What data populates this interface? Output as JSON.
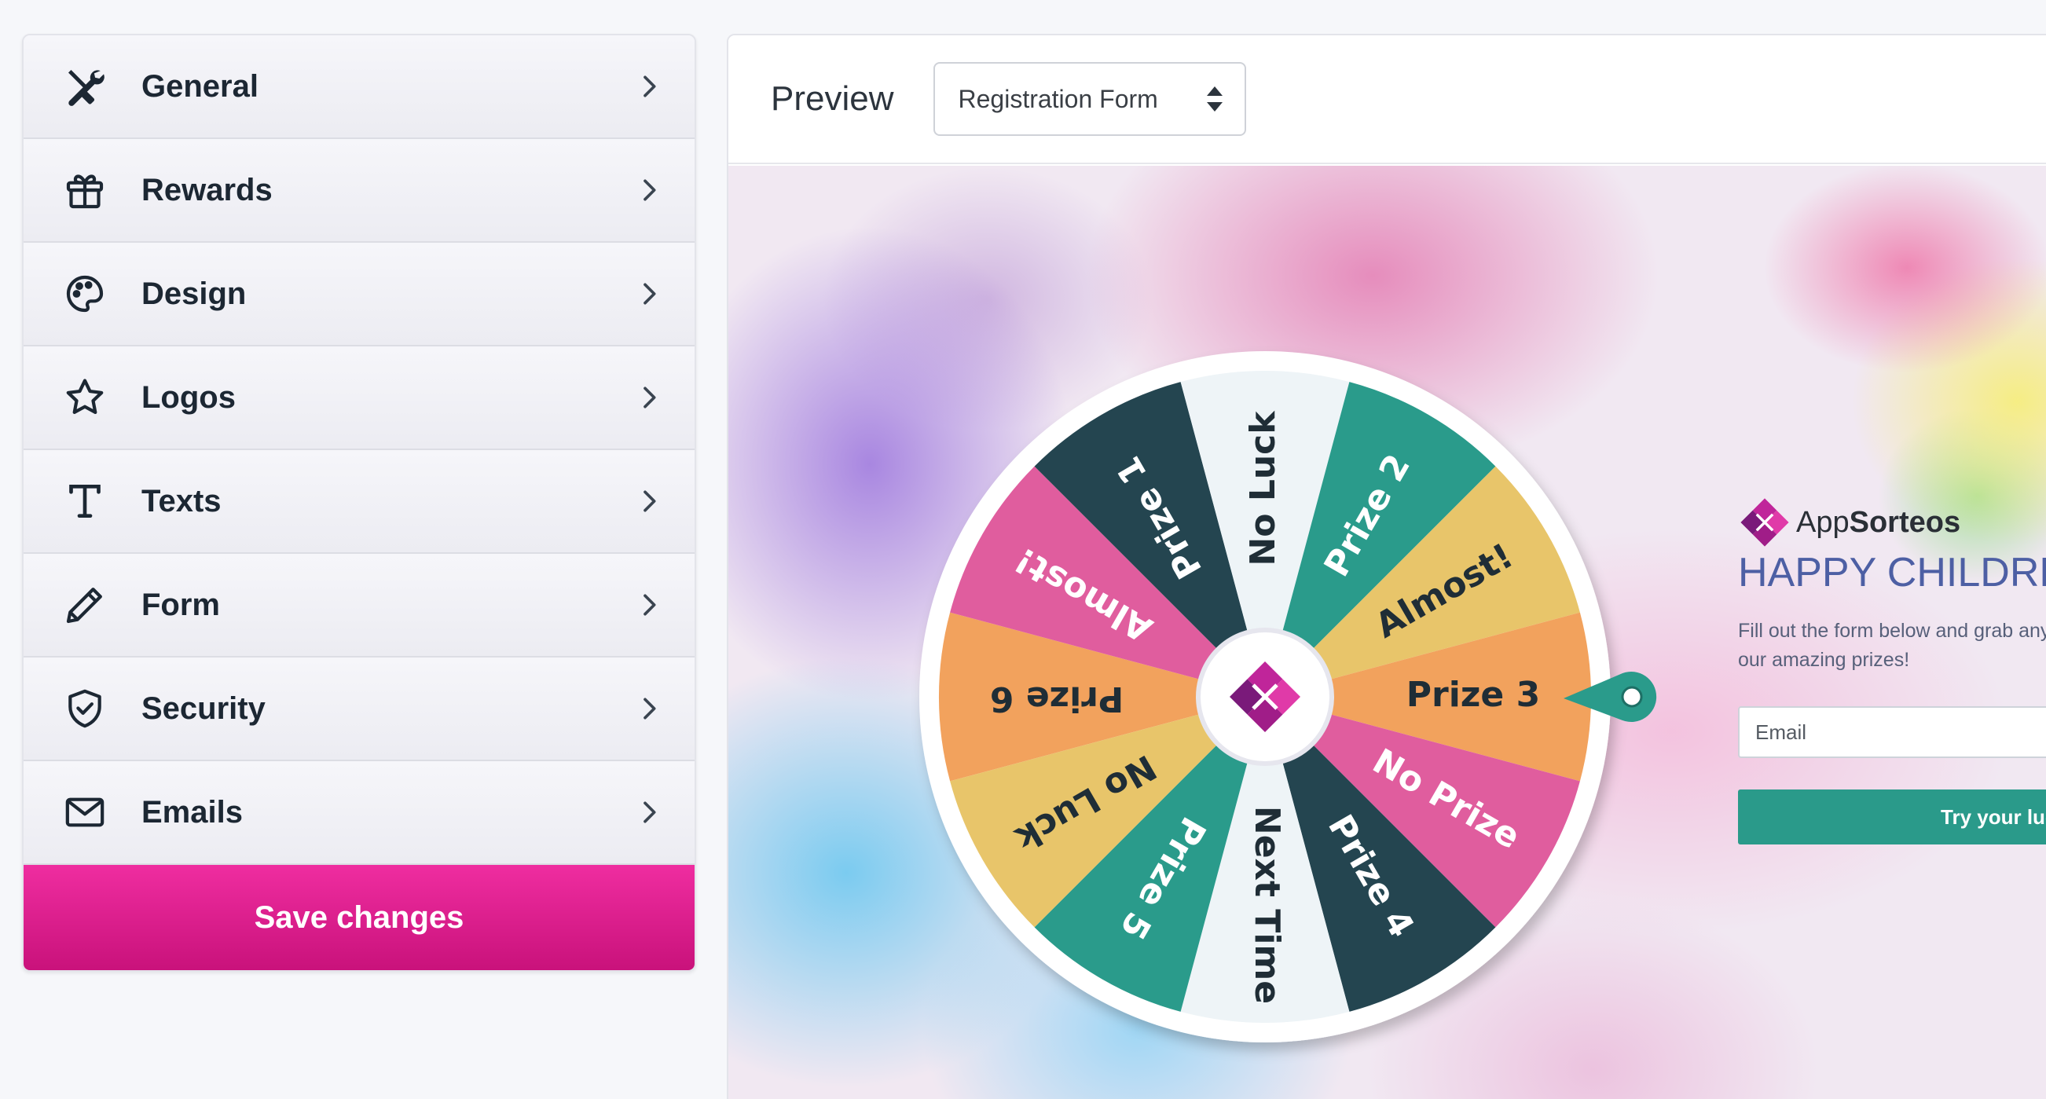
{
  "sidebar": {
    "items": [
      {
        "label": "General",
        "icon": "tools-icon"
      },
      {
        "label": "Rewards",
        "icon": "gift-icon"
      },
      {
        "label": "Design",
        "icon": "palette-icon"
      },
      {
        "label": "Logos",
        "icon": "star-icon"
      },
      {
        "label": "Texts",
        "icon": "text-icon"
      },
      {
        "label": "Form",
        "icon": "pencil-icon"
      },
      {
        "label": "Security",
        "icon": "shield-icon"
      },
      {
        "label": "Emails",
        "icon": "envelope-icon"
      }
    ],
    "save_label": "Save changes",
    "save_color": "#e0208f"
  },
  "preview": {
    "title": "Preview",
    "select_value": "Registration Form"
  },
  "wheel": {
    "segments": [
      {
        "label": "Prize 6",
        "color": "#f2a25d",
        "text_color": "#1f2d36"
      },
      {
        "label": "Almost!",
        "color": "#e05d9e",
        "text_color": "#ffffff"
      },
      {
        "label": "Prize 1",
        "color": "#244550",
        "text_color": "#ffffff"
      },
      {
        "label": "No Luck",
        "color": "#eef4f7",
        "text_color": "#1f2d36"
      },
      {
        "label": "Prize 2",
        "color": "#2a9b8b",
        "text_color": "#ffffff"
      },
      {
        "label": "Almost!",
        "color": "#e8c56a",
        "text_color": "#1f2d36"
      },
      {
        "label": "Prize 3",
        "color": "#f2a25d",
        "text_color": "#1f2d36"
      },
      {
        "label": "No Prize",
        "color": "#e05d9e",
        "text_color": "#ffffff"
      },
      {
        "label": "Prize 4",
        "color": "#244550",
        "text_color": "#ffffff"
      },
      {
        "label": "Next Time",
        "color": "#eef4f7",
        "text_color": "#1f2d36"
      },
      {
        "label": "Prize 5",
        "color": "#2a9b8b",
        "text_color": "#ffffff"
      },
      {
        "label": "No Luck",
        "color": "#e8c56a",
        "text_color": "#1f2d36"
      }
    ],
    "pointer_color": "#2a9b8b"
  },
  "form": {
    "brand_app": "App",
    "brand_name": "Sorteos",
    "headline": "HAPPY CHILDREN",
    "subtext_line1": "Fill out the form below and grab any of",
    "subtext_line2": "our amazing prizes!",
    "email_placeholder": "Email",
    "button_label": "Try your luck",
    "accent_color": "#2a9a8a"
  }
}
